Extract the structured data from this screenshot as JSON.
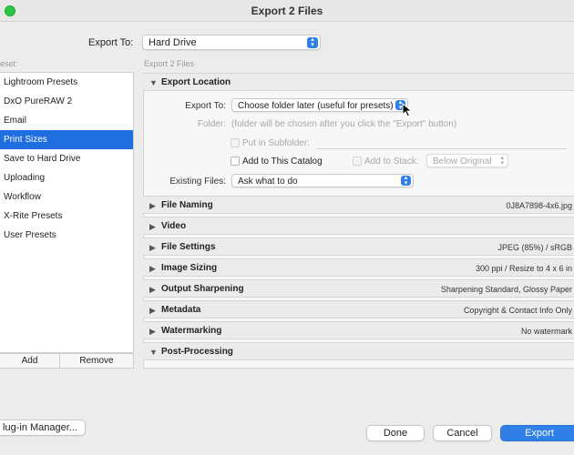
{
  "window": {
    "title": "Export 2 Files"
  },
  "export_to": {
    "label": "Export To:",
    "value": "Hard Drive"
  },
  "preset_header": "eset:",
  "export_files_label": "Export 2 Files",
  "presets": {
    "items": [
      {
        "label": "Lightroom Presets"
      },
      {
        "label": "DxO PureRAW 2"
      },
      {
        "label": "Email"
      },
      {
        "label": "Print Sizes"
      },
      {
        "label": "Save to Hard Drive"
      },
      {
        "label": "Uploading"
      },
      {
        "label": "Workflow"
      },
      {
        "label": "X-Rite Presets"
      },
      {
        "label": "User Presets"
      }
    ],
    "selected_index": 3,
    "add_label": "Add",
    "remove_label": "Remove"
  },
  "export_location": {
    "title": "Export Location",
    "export_to_label": "Export To:",
    "export_to_value": "Choose folder later (useful for presets)",
    "folder_label": "Folder:",
    "folder_hint": "(folder will be chosen after you click the \"Export\" button)",
    "put_in_subfolder_label": "Put in Subfolder:",
    "add_to_catalog_label": "Add to This Catalog",
    "add_to_stack_label": "Add to Stack:",
    "stack_value": "Below Original",
    "existing_files_label": "Existing Files:",
    "existing_files_value": "Ask what to do"
  },
  "sections": [
    {
      "title": "File Naming",
      "summary": "0J8A7898-4x6.jpg"
    },
    {
      "title": "Video",
      "summary": ""
    },
    {
      "title": "File Settings",
      "summary": "JPEG (85%) / sRGB"
    },
    {
      "title": "Image Sizing",
      "summary": "300 ppi / Resize to 4 x 6 in"
    },
    {
      "title": "Output Sharpening",
      "summary": "Sharpening Standard, Glossy Paper"
    },
    {
      "title": "Metadata",
      "summary": "Copyright & Contact Info Only"
    },
    {
      "title": "Watermarking",
      "summary": "No watermark"
    },
    {
      "title": "Post-Processing",
      "summary": ""
    }
  ],
  "footer": {
    "plugin_manager_label": "lug-in Manager...",
    "done_label": "Done",
    "cancel_label": "Cancel",
    "export_label": "Export"
  },
  "colors": {
    "accent": "#2f7fe6",
    "selection": "#1f6ee0"
  }
}
